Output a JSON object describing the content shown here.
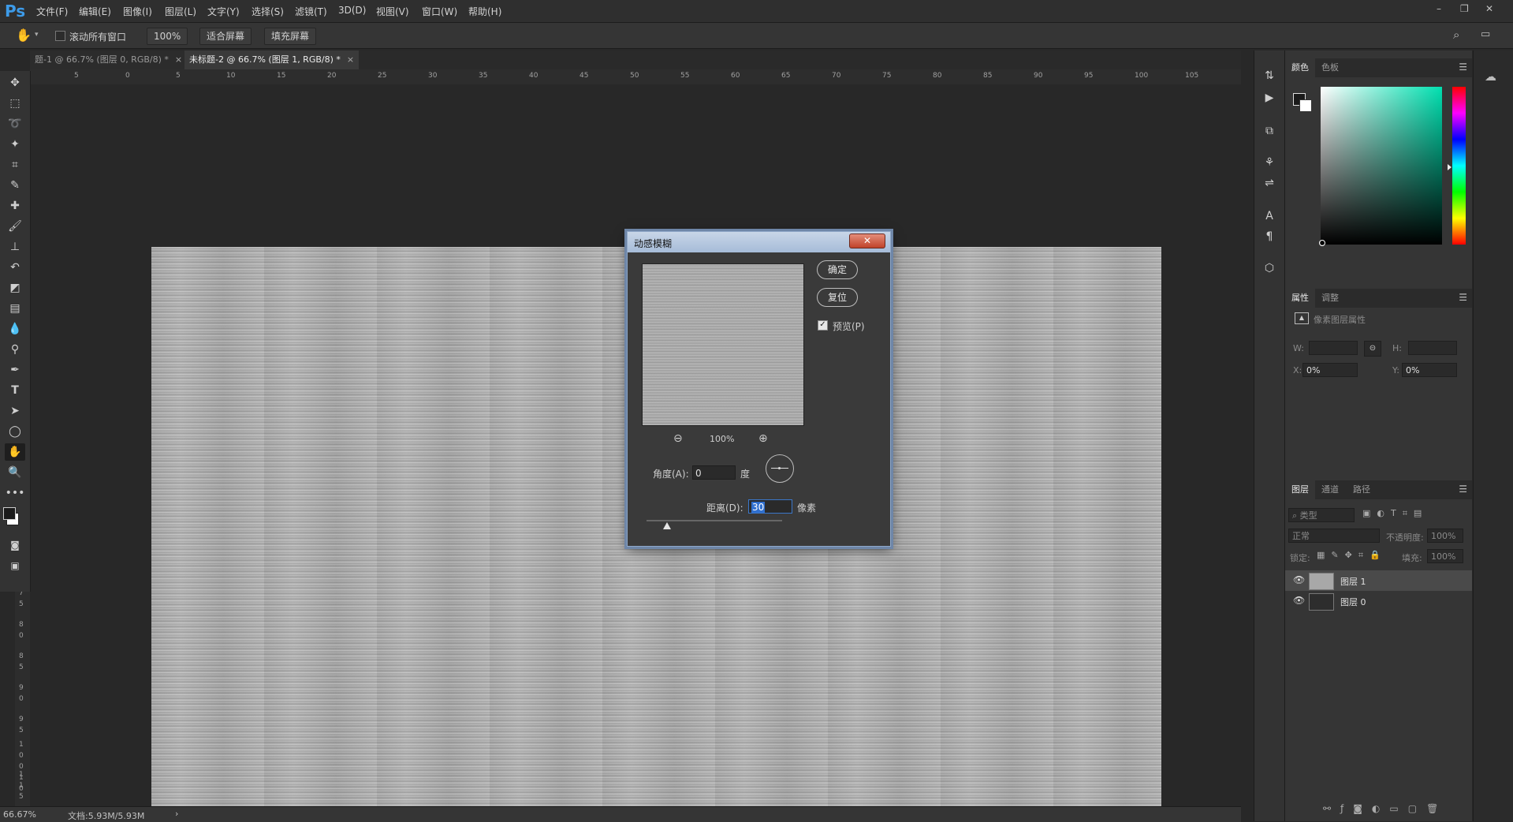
{
  "app": {
    "logo": "Ps"
  },
  "menu": [
    "文件(F)",
    "编辑(E)",
    "图像(I)",
    "图层(L)",
    "文字(Y)",
    "选择(S)",
    "滤镜(T)",
    "3D(D)",
    "视图(V)",
    "窗口(W)",
    "帮助(H)"
  ],
  "window_controls": {
    "minimize": "–",
    "restore": "❐",
    "close": "✕"
  },
  "options": {
    "scroll_all_label": "滚动所有窗口",
    "zoom_value": "100%",
    "fit_screen": "适合屏幕",
    "fill_screen": "填充屏幕"
  },
  "tabs": [
    {
      "label": "题-1 @ 66.7% (图层 0, RGB/8) *",
      "close": "×"
    },
    {
      "label": "未标题-2 @ 66.7% (图层 1, RGB/8) *",
      "close": "×"
    }
  ],
  "ruler_h_ticks": [
    "5",
    "0",
    "5",
    "10",
    "15",
    "20",
    "25",
    "30",
    "35",
    "40",
    "45",
    "50",
    "55",
    "60",
    "65",
    "70",
    "75",
    "80",
    "85",
    "90",
    "95",
    "100",
    "105"
  ],
  "ruler_v_ticks": [
    "7",
    "5",
    "8",
    "0",
    "8",
    "5",
    "9",
    "0",
    "9",
    "5",
    "1",
    "0",
    "0",
    "1",
    "0",
    "5",
    "1",
    "1"
  ],
  "status": {
    "zoom": "66.67%",
    "doc": "文档:5.93M/5.93M",
    "arrow": "›"
  },
  "dialog": {
    "title": "动感模糊",
    "close_glyph": "✕",
    "ok": "确定",
    "reset": "复位",
    "preview_label": "预览(P)",
    "preview_checked": true,
    "zoom": "100%",
    "angle_label": "角度(A):",
    "angle_value": "0",
    "angle_unit": "度",
    "distance_label": "距离(D):",
    "distance_value": "30",
    "distance_unit": "像素",
    "distance_slider_fraction": 0.15
  },
  "color_panel": {
    "tabs": [
      "颜色",
      "色板"
    ],
    "hue_marker_fraction": 0.51
  },
  "properties_panel": {
    "tabs": [
      "属性",
      "调整"
    ],
    "title": "像素图层属性",
    "w_label": "W:",
    "h_label": "H:",
    "x_label": "X:",
    "x_value": "0%",
    "y_label": "Y:",
    "y_value": "0%"
  },
  "layers_panel": {
    "tabs": [
      "图层",
      "通道",
      "路径"
    ],
    "filter": "类型",
    "blend_mode": "正常",
    "opacity_label": "不透明度:",
    "opacity_value": "100%",
    "lock_label": "锁定:",
    "fill_label": "填充:",
    "fill_value": "100%",
    "layers": [
      {
        "name": "图层 1",
        "selected": true
      },
      {
        "name": "图层 0",
        "selected": false
      }
    ]
  },
  "colors": {
    "accent": "#3d9be9",
    "dialog_border": "#8fa7c7",
    "close_red": "#c0432a"
  }
}
